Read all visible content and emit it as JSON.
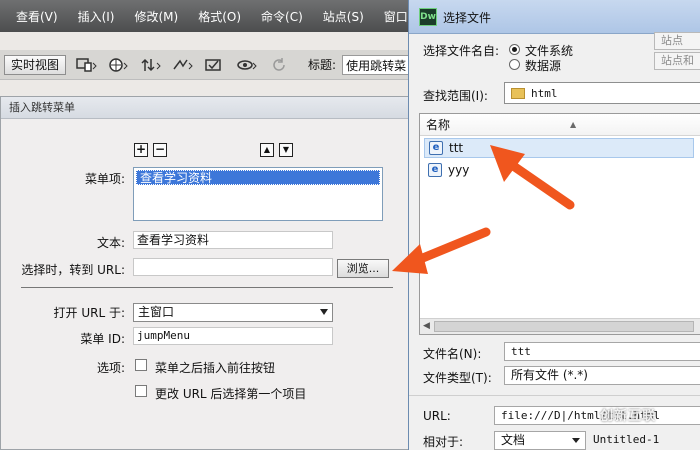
{
  "menubar": {
    "items": [
      "查看(V)",
      "插入(I)",
      "修改(M)",
      "格式(O)",
      "命令(C)",
      "站点(S)",
      "窗口(W"
    ]
  },
  "toolbar": {
    "live_view_label": "实时视图",
    "title_label": "标题:",
    "title_value": "使用跳转菜"
  },
  "jump_dialog": {
    "title": "插入跳转菜单",
    "add_symbol": "+",
    "remove_symbol": "−",
    "up_symbol": "▲",
    "down_symbol": "▼",
    "menu_items_label": "菜单项:",
    "menu_items": [
      "查看学习资料"
    ],
    "text_label": "文本:",
    "text_value": "查看学习资料",
    "url_label": "选择时，转到 URL:",
    "url_value": "",
    "browse_label": "浏览...",
    "open_in_label": "打开 URL 于:",
    "open_in_value": "主窗口",
    "menu_id_label": "菜单 ID:",
    "menu_id_value": "jumpMenu",
    "options_label": "选项:",
    "option1": "菜单之后插入前往按钮",
    "option2": "更改 URL 后选择第一个项目"
  },
  "file_dialog": {
    "logo": "Dw",
    "title": "选择文件",
    "select_from_label": "选择文件名自:",
    "radio_filesystem": "文件系统",
    "radio_datasource": "数据源",
    "site_btn1": "站点",
    "site_btn2": "站点和",
    "lookin_label": "查找范围(I):",
    "lookin_value": "html",
    "column_name": "名称",
    "files": [
      {
        "name": "ttt",
        "selected": true
      },
      {
        "name": "yyy",
        "selected": false
      }
    ],
    "filename_label": "文件名(N):",
    "filename_value": "ttt",
    "filetype_label": "文件类型(T):",
    "filetype_value": "所有文件 (*.*)",
    "url_label": "URL:",
    "url_value": "file:///D|/html/ttt.html",
    "relative_label": "相对于:",
    "relative_value": "文档",
    "relative_doc": "Untitled-1"
  },
  "watermark": "创新互联",
  "colors": {
    "annotation_arrow": "#f0561e",
    "selection": "#3d77d9"
  }
}
